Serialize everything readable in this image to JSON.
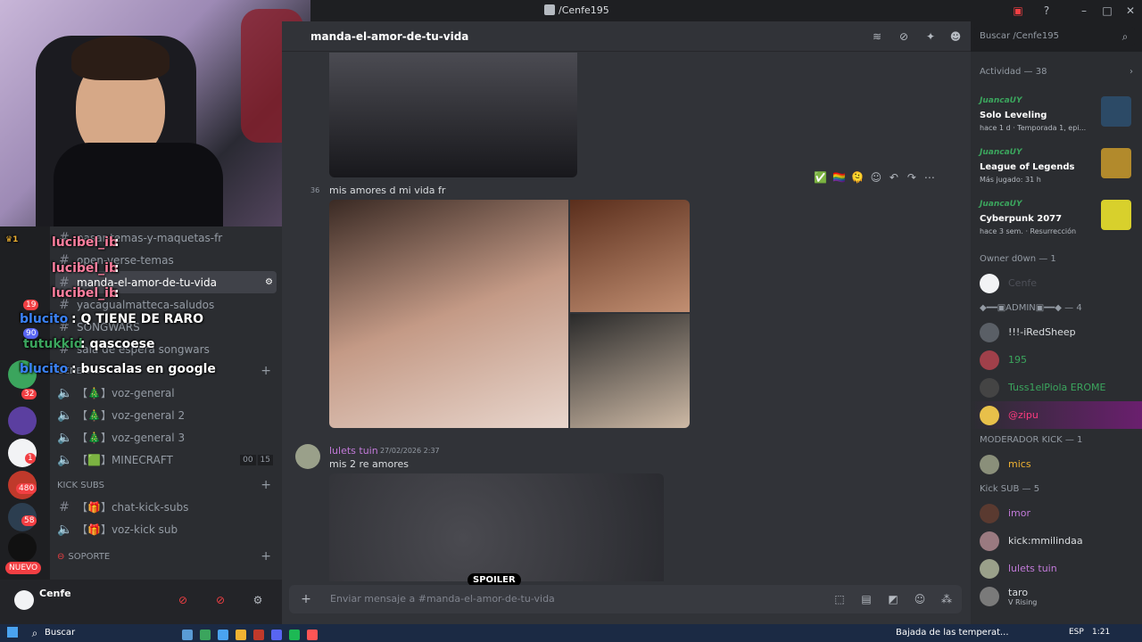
{
  "window": {
    "title": "/Cenfe195"
  },
  "channel_header": {
    "name": "manda-el-amor-de-tu-vida",
    "search_placeholder": "Buscar /Cenfe195"
  },
  "channels": {
    "items": [
      {
        "label": "pasar-temas-y-maquetas-fr"
      },
      {
        "label": "open-verse-temas"
      },
      {
        "label": "manda-el-amor-de-tu-vida"
      },
      {
        "label": "yacagualmatteca-saludos"
      },
      {
        "label": "SONGWARS"
      },
      {
        "label": "sala de espera songwars"
      }
    ],
    "cat_general": "GENERAL",
    "voice": [
      {
        "label": "【🎄】voz-general"
      },
      {
        "label": "【🎄】voz-general 2"
      },
      {
        "label": "【🎄】voz-general 3"
      },
      {
        "label": "【🟩】MINECRAFT",
        "b1": "00",
        "b2": "15"
      }
    ],
    "cat_kick": "KICK SUBS",
    "kick": [
      {
        "label": "【🎁】chat-kick-subs"
      },
      {
        "label": "【🎁】voz-kick sub"
      }
    ],
    "cat_soporte": "SOPORTE"
  },
  "servers": {
    "badges": [
      "19",
      "90",
      "32",
      "1",
      "480",
      "58"
    ],
    "new_label": "NUEVO"
  },
  "user": {
    "name": "Cenfe"
  },
  "stream_chat": [
    {
      "user": "lucibel_ib",
      "text": ":"
    },
    {
      "user": "lucibel_ib",
      "text": ":"
    },
    {
      "user": "lucibel_ib",
      "text": ":"
    },
    {
      "user": "blucito",
      "text": ": Q TIENE DE RARO"
    },
    {
      "user": "tutukkid",
      "text": ": qascoese"
    },
    {
      "user": "blucito",
      "text": ": buscalas en google"
    }
  ],
  "messages": {
    "time_fragment": "36",
    "msg1": "mis amores d mi vida fr",
    "reactions": [
      "✅",
      "🏳️‍🌈",
      "🫠"
    ],
    "author2": "lulets tuin",
    "timestamp2": "27/02/2026 2:37",
    "msg2": "mis 2 re amores",
    "spoiler": "SPOILER",
    "input_placeholder": "Enviar mensaje a #manda-el-amor-de-tu-vida"
  },
  "activity": {
    "header": "Actividad — 38",
    "items": [
      {
        "player": "JuancaUY",
        "title": "Solo Leveling",
        "sub": "hace 1 d · Temporada 1, epi...",
        "color": "#2c4a66"
      },
      {
        "player": "JuancaUY",
        "title": "League of Legends",
        "sub": "Más jugado: 31 h",
        "color": "#b28a2c"
      },
      {
        "player": "JuancaUY",
        "title": "Cyberpunk 2077",
        "sub": "hace 3 sem. · Resurrección",
        "color": "#d8d02c"
      }
    ]
  },
  "member_list": {
    "owner_header": "Owner d0wn — 1",
    "owner": [
      {
        "name": "Cenfe"
      }
    ],
    "admin_header": "◆━━▣ADMIN▣━━◆ — 4",
    "admins": [
      {
        "name": "!!!-iRedSheep",
        "color": "#dbdee1"
      },
      {
        "name": "195",
        "color": "#3ba55d"
      },
      {
        "name": "Tuss1elPiola EROME",
        "color": "#3ba55d"
      },
      {
        "name": "@zipu",
        "color": "#ff3b7f"
      }
    ],
    "mod_header": "MODERADOR KICK — 1",
    "mods": [
      {
        "name": "mics",
        "color": "#f0b232"
      }
    ],
    "sub_header": "Kick SUB — 5",
    "subs": [
      {
        "name": "imor",
        "color": "#c27ad9"
      },
      {
        "name": "kick:mmilindaa",
        "color": "#dbdee1"
      },
      {
        "name": "lulets tuin",
        "color": "#c27ad9"
      },
      {
        "name": "taro",
        "color": "#dbdee1",
        "sub": "V Rising"
      }
    ]
  },
  "taskbar": {
    "search": "Buscar",
    "weather": "Bajada de las temperat...",
    "lang": "ESP",
    "time": "1:21"
  }
}
